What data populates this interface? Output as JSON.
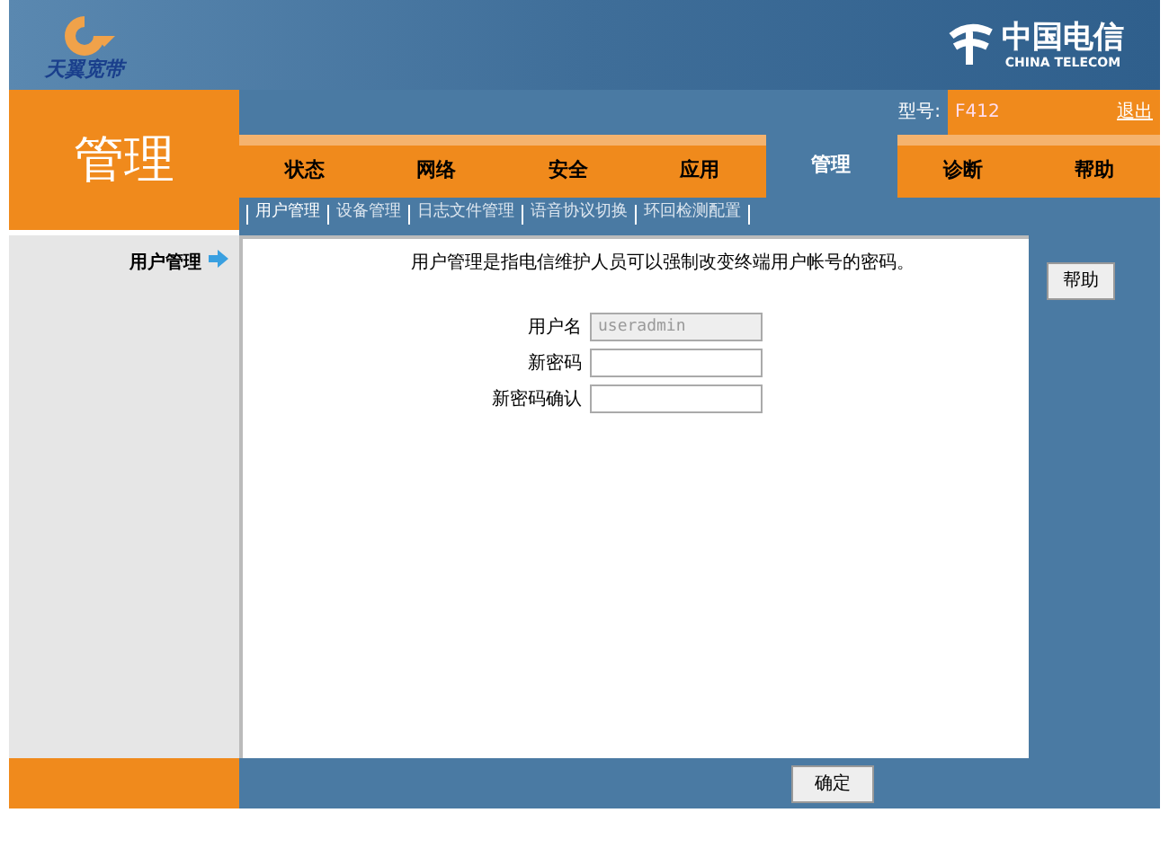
{
  "brand": {
    "left_logo": "天翼宽带",
    "right_logo": "中国电信",
    "right_logo_en": "CHINA TELECOM"
  },
  "section_title": "管理",
  "model": {
    "label": "型号:",
    "value": "F412"
  },
  "logout": "退出",
  "tabs": [
    {
      "label": "状态",
      "selected": false
    },
    {
      "label": "网络",
      "selected": false
    },
    {
      "label": "安全",
      "selected": false
    },
    {
      "label": "应用",
      "selected": false
    },
    {
      "label": "管理",
      "selected": true
    },
    {
      "label": "诊断",
      "selected": false
    },
    {
      "label": "帮助",
      "selected": false
    }
  ],
  "subtabs": [
    {
      "label": "用户管理",
      "selected": true
    },
    {
      "label": "设备管理",
      "selected": false
    },
    {
      "label": "日志文件管理",
      "selected": false
    },
    {
      "label": "语音协议切换",
      "selected": false
    },
    {
      "label": "环回检测配置",
      "selected": false
    }
  ],
  "sidebar": {
    "item": "用户管理"
  },
  "description": "用户管理是指电信维护人员可以强制改变终端用户帐号的密码。",
  "fields": [
    {
      "label": "用户名",
      "value": "useradmin",
      "disabled": true
    },
    {
      "label": "新密码",
      "disabled": false
    },
    {
      "label": "新密码确认",
      "disabled": false
    }
  ],
  "help_button": "帮助",
  "footer_button": "确定"
}
